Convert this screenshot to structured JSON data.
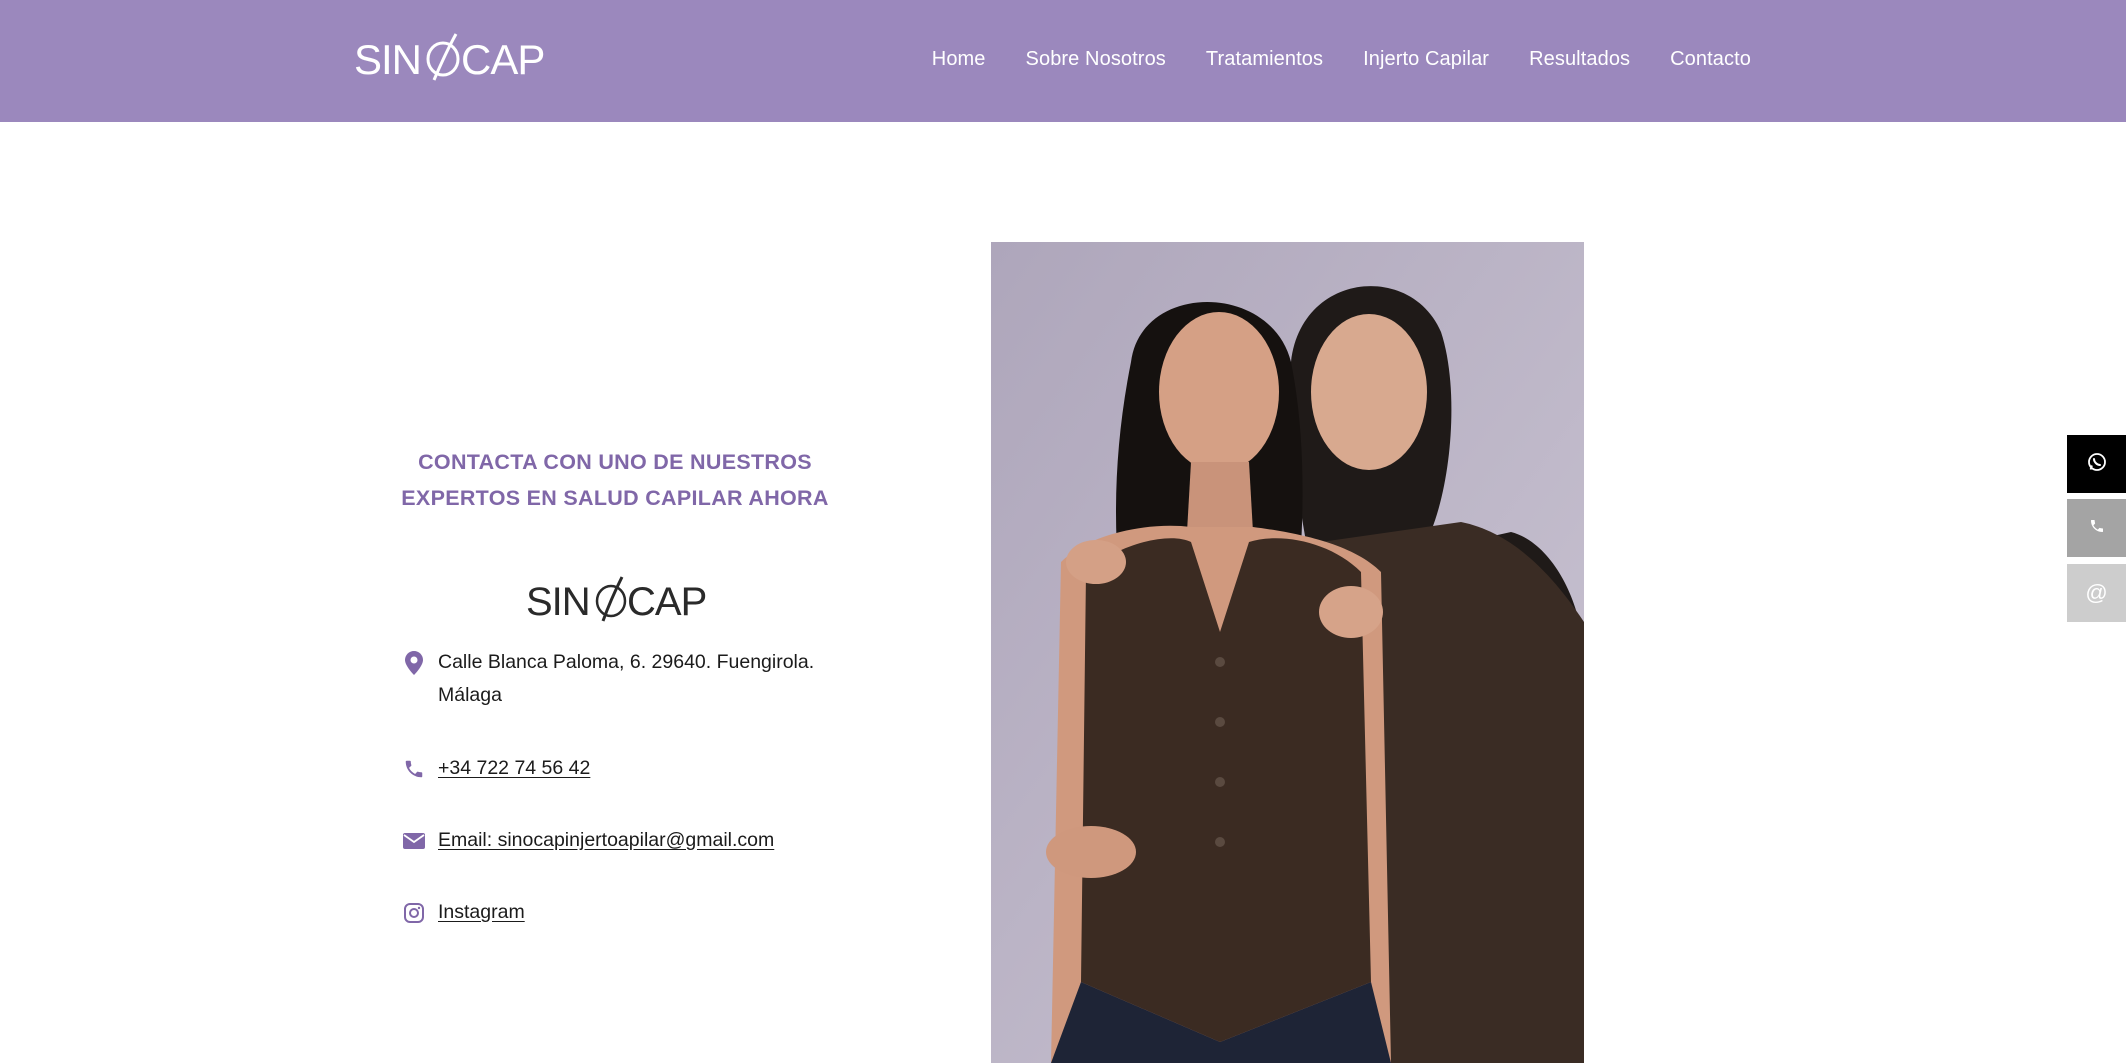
{
  "brand": {
    "name": "SINOCAP",
    "accent_color": "#9b88bd",
    "heading_color": "#8067a8"
  },
  "nav": {
    "items": [
      {
        "label": "Home"
      },
      {
        "label": "Sobre Nosotros"
      },
      {
        "label": "Tratamientos"
      },
      {
        "label": "Injerto Capilar"
      },
      {
        "label": "Resultados"
      },
      {
        "label": "Contacto"
      }
    ]
  },
  "contact": {
    "heading_line1": "CONTACTA CON UNO DE NUESTROS",
    "heading_line2": "EXPERTOS EN SALUD CAPILAR AHORA",
    "address_line1": "Calle Blanca Paloma, 6. 29640. Fuengirola.",
    "address_line2": "Málaga",
    "phone": "+34 722 74 56 42",
    "email": "Email: sinocapinjertoapilar@gmail.com",
    "instagram": "Instagram",
    "icons": {
      "address": "map-pin-icon",
      "phone": "phone-icon",
      "email": "envelope-icon",
      "instagram": "instagram-icon"
    }
  },
  "side_buttons": {
    "whatsapp_icon": "whatsapp-icon",
    "phone_icon": "phone-icon",
    "email_symbol": "@"
  }
}
